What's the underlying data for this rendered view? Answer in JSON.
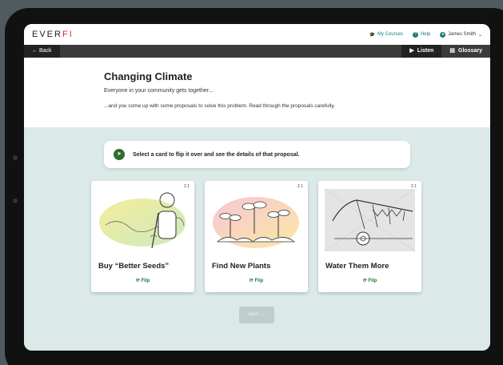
{
  "topbar": {
    "logo_prefix": "EVER",
    "logo_suffix": "FI",
    "my_courses": "My Courses",
    "help": "Help",
    "user": "James Smith"
  },
  "toolbar": {
    "back": "← Back",
    "listen": "Listen",
    "glossary": "Glossary"
  },
  "header": {
    "title": "Changing Climate",
    "subtitle": "Everyone in your community gets together...",
    "description": "...and you come up with some proposals to solve this problem. Read through the proposals carefully."
  },
  "instruction": "Select a card to flip it over and see the details of that proposal.",
  "cards": [
    {
      "number": "2.1",
      "title": "Buy “Better Seeds”",
      "flip": "Flip",
      "icon": "fertilizer-sprayer-illustration"
    },
    {
      "number": "2.1",
      "title": "Find New Plants",
      "flip": "Flip",
      "icon": "seedlings-illustration"
    },
    {
      "number": "2.1",
      "title": "Water Them More",
      "flip": "Flip",
      "icon": "irrigation-system-illustration"
    }
  ],
  "next_label": "Next →",
  "colors": {
    "accent": "#1a7d7a",
    "green": "#2c6e2f",
    "main_bg": "#dbeae8",
    "toolbar": "#3a3a3a"
  }
}
